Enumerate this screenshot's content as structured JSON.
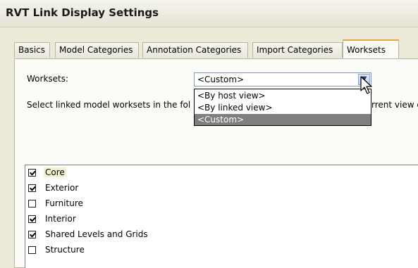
{
  "window": {
    "title": "RVT Link Display Settings"
  },
  "tabs": [
    {
      "label": "Basics",
      "active": false
    },
    {
      "label": "Model Categories",
      "active": false
    },
    {
      "label": "Annotation Categories",
      "active": false
    },
    {
      "label": "Import Categories",
      "active": false
    },
    {
      "label": "Worksets",
      "active": true
    }
  ],
  "worksets_panel": {
    "worksets_label": "Worksets:",
    "combo_value": "<Custom>",
    "dropdown_options": [
      {
        "label": "<By host view>",
        "selected": false
      },
      {
        "label": "<By linked view>",
        "selected": false
      },
      {
        "label": "<Custom>",
        "selected": true
      }
    ],
    "instruction_left": "Select linked model worksets in the fol",
    "instruction_right": "rrent view d",
    "items": [
      {
        "label": "Core",
        "checked": true
      },
      {
        "label": "Exterior",
        "checked": true
      },
      {
        "label": "Furniture",
        "checked": false
      },
      {
        "label": "Interior",
        "checked": true
      },
      {
        "label": "Shared Levels and Grids",
        "checked": true
      },
      {
        "label": "Structure",
        "checked": false
      }
    ]
  },
  "colors": {
    "active_tab_accent": "#e8a53a",
    "selected_option_bg": "#7f7f7f"
  }
}
